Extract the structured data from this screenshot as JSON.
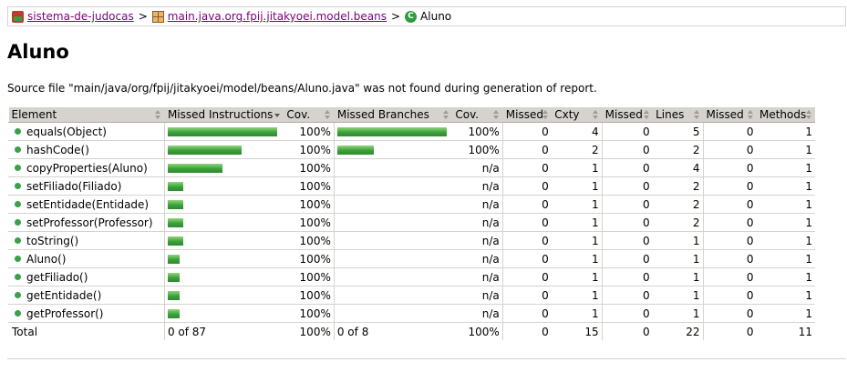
{
  "breadcrumb": {
    "items": [
      {
        "label": "sistema-de-judocas",
        "icon": "session-icon",
        "link": true
      },
      {
        "label": "main.java.org.fpij.jitakyoei.model.beans",
        "icon": "package-icon",
        "link": true
      },
      {
        "label": "Aluno",
        "icon": "class-icon",
        "link": false
      }
    ],
    "separator": ">"
  },
  "page_title": "Aluno",
  "source_note": "Source file \"main/java/org/fpij/jitakyoei/model/beans/Aluno.java\" was not found during generation of report.",
  "table": {
    "headers": [
      "Element",
      "Missed Instructions",
      "Cov.",
      "Missed Branches",
      "Cov.",
      "Missed",
      "Cxty",
      "Missed",
      "Lines",
      "Missed",
      "Methods"
    ],
    "rows": [
      {
        "element": "equals(Object)",
        "instr_covered": 28,
        "instr_cov": "100%",
        "branch_covered": 6,
        "branch_cov": "100%",
        "missed_cxty": "0",
        "cxty": "4",
        "missed_lines": "0",
        "lines": "5",
        "missed_methods": "0",
        "methods": "1"
      },
      {
        "element": "hashCode()",
        "instr_covered": 19,
        "instr_cov": "100%",
        "branch_covered": 2,
        "branch_cov": "100%",
        "missed_cxty": "0",
        "cxty": "2",
        "missed_lines": "0",
        "lines": "2",
        "missed_methods": "0",
        "methods": "1"
      },
      {
        "element": "copyProperties(Aluno)",
        "instr_covered": 14,
        "instr_cov": "100%",
        "branch_covered": 0,
        "branch_cov": "n/a",
        "missed_cxty": "0",
        "cxty": "1",
        "missed_lines": "0",
        "lines": "4",
        "missed_methods": "0",
        "methods": "1"
      },
      {
        "element": "setFiliado(Filiado)",
        "instr_covered": 4,
        "instr_cov": "100%",
        "branch_covered": 0,
        "branch_cov": "n/a",
        "missed_cxty": "0",
        "cxty": "1",
        "missed_lines": "0",
        "lines": "2",
        "missed_methods": "0",
        "methods": "1"
      },
      {
        "element": "setEntidade(Entidade)",
        "instr_covered": 4,
        "instr_cov": "100%",
        "branch_covered": 0,
        "branch_cov": "n/a",
        "missed_cxty": "0",
        "cxty": "1",
        "missed_lines": "0",
        "lines": "2",
        "missed_methods": "0",
        "methods": "1"
      },
      {
        "element": "setProfessor(Professor)",
        "instr_covered": 4,
        "instr_cov": "100%",
        "branch_covered": 0,
        "branch_cov": "n/a",
        "missed_cxty": "0",
        "cxty": "1",
        "missed_lines": "0",
        "lines": "2",
        "missed_methods": "0",
        "methods": "1"
      },
      {
        "element": "toString()",
        "instr_covered": 4,
        "instr_cov": "100%",
        "branch_covered": 0,
        "branch_cov": "n/a",
        "missed_cxty": "0",
        "cxty": "1",
        "missed_lines": "0",
        "lines": "1",
        "missed_methods": "0",
        "methods": "1"
      },
      {
        "element": "Aluno()",
        "instr_covered": 3,
        "instr_cov": "100%",
        "branch_covered": 0,
        "branch_cov": "n/a",
        "missed_cxty": "0",
        "cxty": "1",
        "missed_lines": "0",
        "lines": "1",
        "missed_methods": "0",
        "methods": "1"
      },
      {
        "element": "getFiliado()",
        "instr_covered": 3,
        "instr_cov": "100%",
        "branch_covered": 0,
        "branch_cov": "n/a",
        "missed_cxty": "0",
        "cxty": "1",
        "missed_lines": "0",
        "lines": "1",
        "missed_methods": "0",
        "methods": "1"
      },
      {
        "element": "getEntidade()",
        "instr_covered": 3,
        "instr_cov": "100%",
        "branch_covered": 0,
        "branch_cov": "n/a",
        "missed_cxty": "0",
        "cxty": "1",
        "missed_lines": "0",
        "lines": "1",
        "missed_methods": "0",
        "methods": "1"
      },
      {
        "element": "getProfessor()",
        "instr_covered": 3,
        "instr_cov": "100%",
        "branch_covered": 0,
        "branch_cov": "n/a",
        "missed_cxty": "0",
        "cxty": "1",
        "missed_lines": "0",
        "lines": "1",
        "missed_methods": "0",
        "methods": "1"
      }
    ],
    "total": {
      "label": "Total",
      "instr": "0 of 87",
      "instr_cov": "100%",
      "branch": "0 of 8",
      "branch_cov": "100%",
      "missed_cxty": "0",
      "cxty": "15",
      "missed_lines": "0",
      "lines": "22",
      "missed_methods": "0",
      "methods": "11"
    }
  },
  "colors": {
    "bar_green": "#3aa03a",
    "header_bg": "#d6d3ce",
    "link": "#800080",
    "method_dot": "#3aa04a"
  }
}
